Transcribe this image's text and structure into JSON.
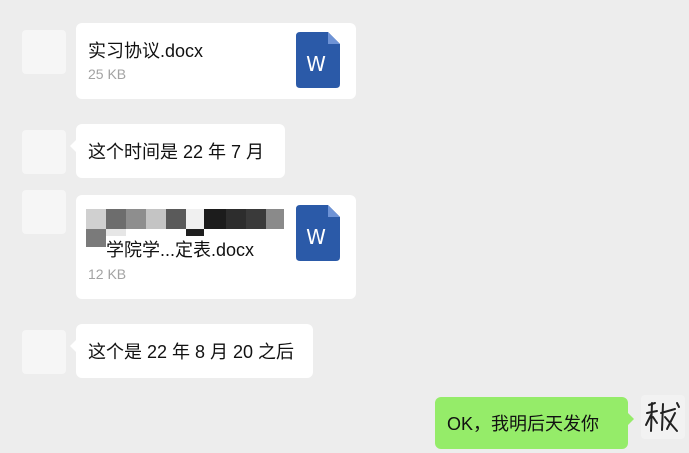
{
  "messages": [
    {
      "type": "file",
      "name": "实习协议.docx",
      "size": "25 KB",
      "file_icon": "word-icon",
      "file_icon_letter": "W"
    },
    {
      "type": "text",
      "text": "这个时间是 22 年 7 月"
    },
    {
      "type": "file",
      "name": "学院学...定表.docx",
      "size": "12 KB",
      "file_icon": "word-icon",
      "file_icon_letter": "W",
      "redacted": true
    },
    {
      "type": "text",
      "text": "这个是 22 年 8 月 20 之后"
    },
    {
      "type": "text",
      "outgoing": true,
      "text": "OK，我明后天发你"
    }
  ],
  "colors": {
    "background": "#ededed",
    "incoming_bubble": "#ffffff",
    "outgoing_bubble": "#95ec69",
    "word_blue": "#2b5aa8",
    "secondary_text": "#a3a3a3"
  }
}
